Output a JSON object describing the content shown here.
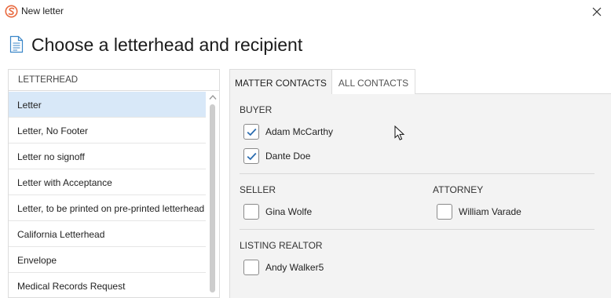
{
  "window": {
    "title": "New letter",
    "app_icon": "app-logo-icon",
    "close_icon": "close-icon",
    "accent_color": "#e8693e"
  },
  "page": {
    "heading": "Choose a letterhead and recipient",
    "heading_icon": "document-icon"
  },
  "letterhead": {
    "header": "LETTERHEAD",
    "selected_index": 0,
    "items": [
      "Letter",
      "Letter, No Footer",
      "Letter no signoff",
      "Letter with Acceptance",
      "Letter, to be printed on pre-printed letterhead",
      "California Letterhead",
      "Envelope",
      "Medical Records Request"
    ]
  },
  "tabs": {
    "matter_contacts": "MATTER CONTACTS",
    "all_contacts": "ALL CONTACTS",
    "active": "matter_contacts"
  },
  "groups": {
    "buyer": {
      "label": "BUYER",
      "contacts": [
        {
          "name": "Adam McCarthy",
          "checked": true
        },
        {
          "name": "Dante Doe",
          "checked": true
        }
      ]
    },
    "seller": {
      "label": "SELLER",
      "contacts": [
        {
          "name": "Gina Wolfe",
          "checked": false
        }
      ]
    },
    "attorney": {
      "label": "ATTORNEY",
      "contacts": [
        {
          "name": "William Varade",
          "checked": false
        }
      ]
    },
    "listing_realtor": {
      "label": "LISTING REALTOR",
      "contacts": [
        {
          "name": "Andy Walker5",
          "checked": false
        }
      ]
    }
  },
  "colors": {
    "selected_row": "#d8e8f8",
    "checkbox_check": "#2b6cb0",
    "contacts_background": "#f3f3f3"
  }
}
